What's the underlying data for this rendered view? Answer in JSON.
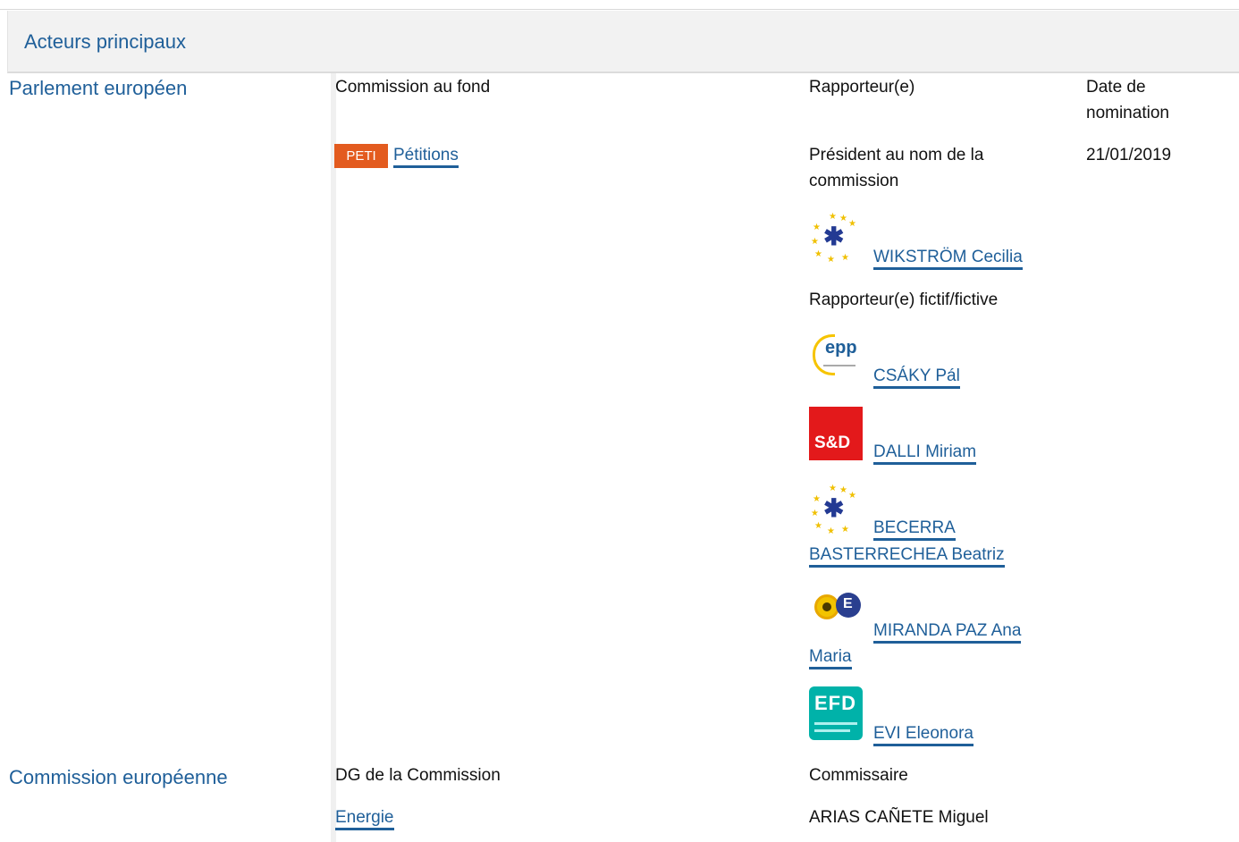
{
  "header": {
    "title": "Acteurs principaux"
  },
  "parlement": {
    "label": "Parlement européen",
    "col1_header": "Commission au fond",
    "col2_header": "Rapporteur(e)",
    "col3_header": "Date de\nnomination",
    "committee": {
      "code": "PETI",
      "name": "Pétitions"
    },
    "rapporteur_role": "Président au nom de la commission",
    "date": "21/01/2019",
    "rapporteur": {
      "name": "WIKSTRÖM Cecilia",
      "group_icon": "renew-europe-logo"
    },
    "shadow_header": "Rapporteur(e) fictif/fictive",
    "shadows": [
      {
        "name": "CSÁKY Pál",
        "group_icon": "epp-logo"
      },
      {
        "name": "DALLI Miriam",
        "group_icon": "s-and-d-logo",
        "logo_text": "S&D"
      },
      {
        "name_line1": "BECERRA",
        "name_line2": "BASTERRECHEA Beatriz",
        "group_icon": "renew-europe-logo"
      },
      {
        "name_line1": "MIRANDA PAZ Ana",
        "name_line2": "Maria",
        "group_icon": "greens-efa-logo"
      },
      {
        "name": "EVI Eleonora",
        "group_icon": "efdd-logo",
        "logo_text": "EFD"
      }
    ]
  },
  "commission": {
    "label": "Commission européenne",
    "col1_header": "DG de la Commission",
    "col2_header": "Commissaire",
    "dg": "Energie",
    "commissioner": "ARIAS CAÑETE Miguel"
  },
  "colors": {
    "link": "#1f5f99",
    "badge": "#e35b1f",
    "header_bg": "#f2f2f2"
  }
}
